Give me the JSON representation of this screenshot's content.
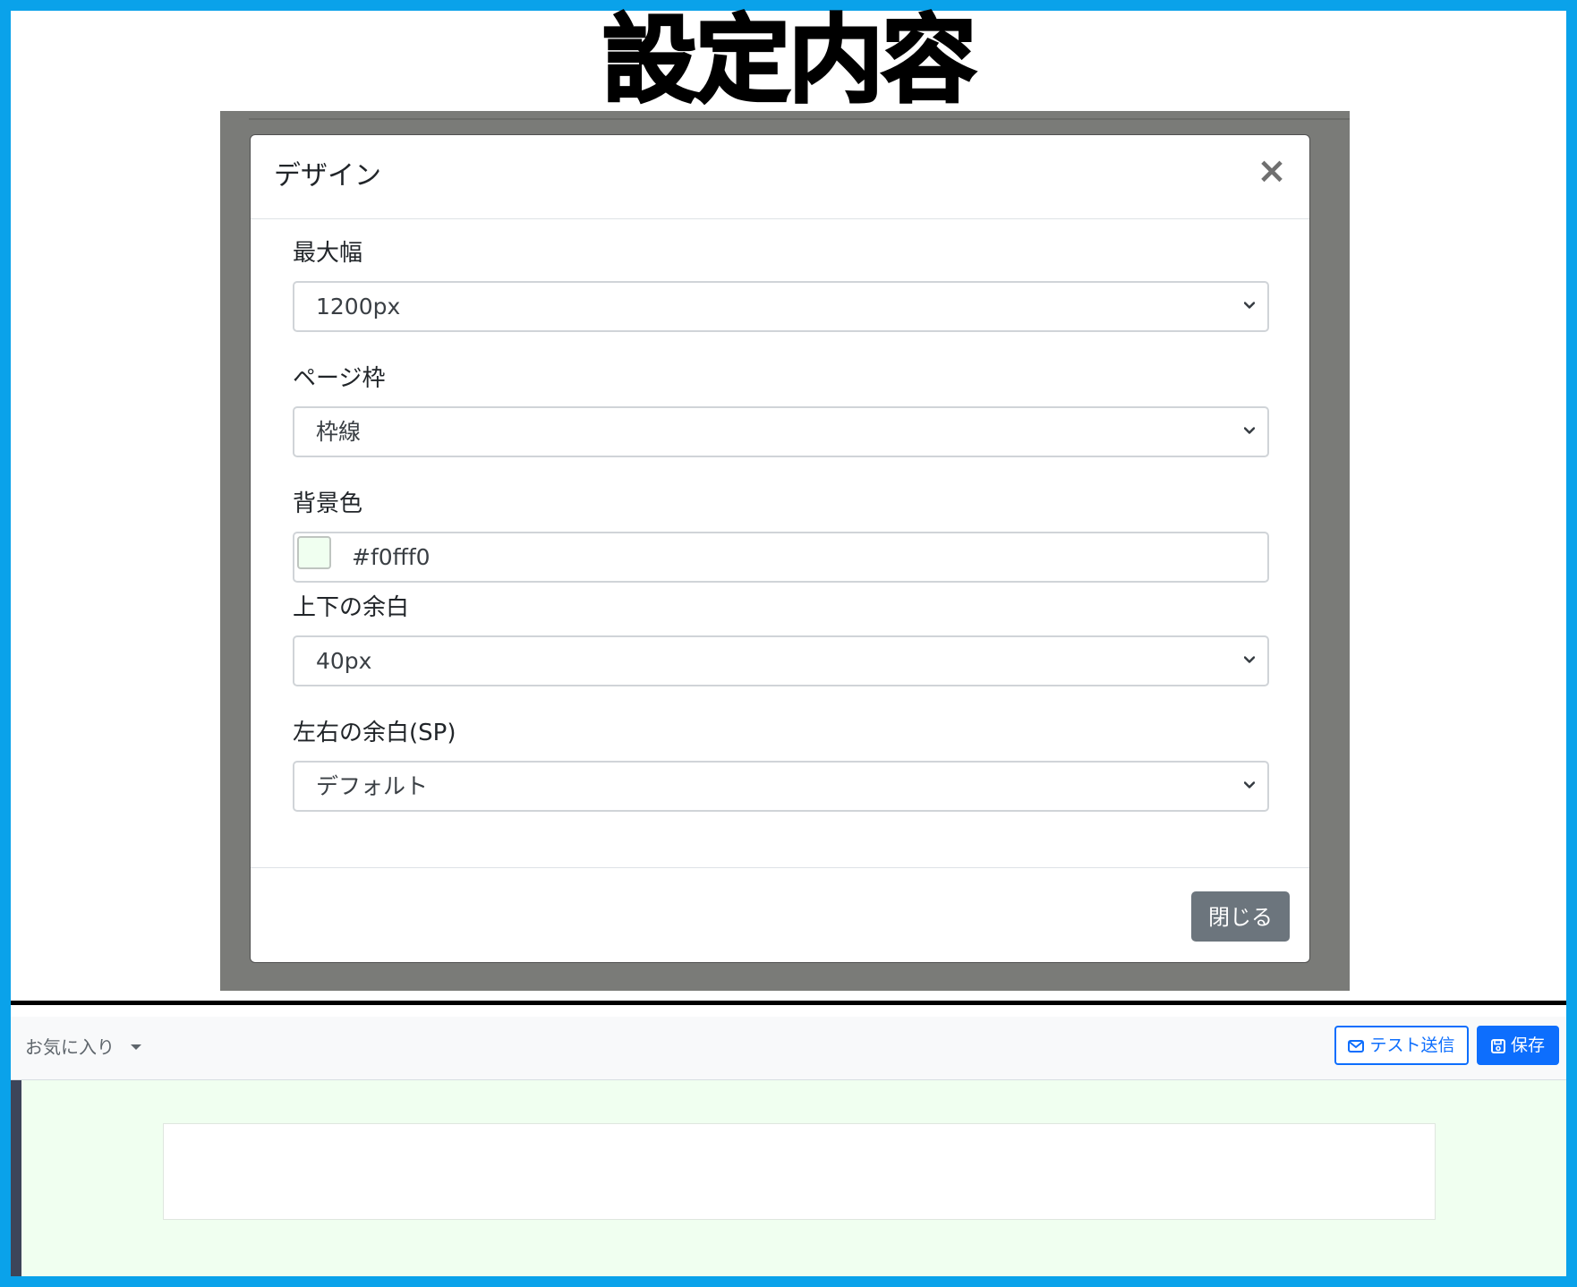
{
  "heading": "設定内容",
  "modal": {
    "title": "デザイン",
    "close_symbol": "×",
    "fields": {
      "max_width": {
        "label": "最大幅",
        "value": "1200px"
      },
      "page_frame": {
        "label": "ページ枠",
        "value": "枠線"
      },
      "background_color": {
        "label": "背景色",
        "value": "#f0fff0",
        "swatch_color": "#f0fff0"
      },
      "vertical_margin": {
        "label": "上下の余白",
        "value": "40px"
      },
      "horizontal_margin_sp": {
        "label": "左右の余白(SP)",
        "value": "デフォルト"
      }
    },
    "footer": {
      "close_label": "閉じる"
    }
  },
  "toolbar": {
    "favorites_label": "お気に入り",
    "test_send_label": "テスト送信",
    "save_label": "保存",
    "icons": {
      "test_send": "envelope-icon",
      "save": "floppy-disk-icon",
      "favorites": "caret-down-icon"
    }
  },
  "colors": {
    "frame": "#0aa2ea",
    "primary": "#0d6efd",
    "secondary": "#6c757d",
    "preview_background": "#f0fff0"
  }
}
